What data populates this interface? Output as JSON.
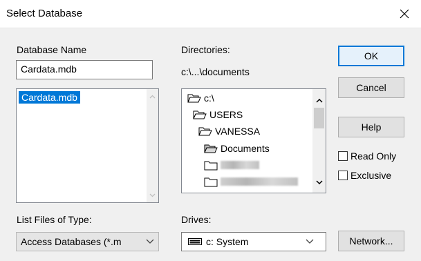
{
  "dialog": {
    "title": "Select Database",
    "close_glyph": "✕"
  },
  "database_name": {
    "label": "Database Name",
    "value": "Cardata.mdb",
    "files": [
      "Cardata.mdb"
    ],
    "selected": "Cardata.mdb"
  },
  "directories": {
    "label": "Directories:",
    "current_path": "c:\\...\\documents",
    "items": [
      {
        "name": "c:\\",
        "icon": "open-folder-icon"
      },
      {
        "name": "USERS",
        "icon": "open-folder-icon"
      },
      {
        "name": "VANESSA",
        "icon": "open-folder-icon"
      },
      {
        "name": "Documents",
        "icon": "open-folder-icon"
      },
      {
        "name": "",
        "icon": "closed-folder-icon"
      },
      {
        "name": "",
        "icon": "closed-folder-icon"
      }
    ]
  },
  "list_files_of_type": {
    "label": "List Files of Type:",
    "value": "Access Databases (*.m"
  },
  "drives": {
    "label": "Drives:",
    "value": "c: System",
    "icon": "drive-icon"
  },
  "buttons": {
    "ok": "OK",
    "cancel": "Cancel",
    "help": "Help",
    "network": "Network..."
  },
  "options": {
    "read_only": "Read Only",
    "exclusive": "Exclusive"
  },
  "colors": {
    "selection": "#0078d7",
    "default_border": "#0078d7"
  }
}
